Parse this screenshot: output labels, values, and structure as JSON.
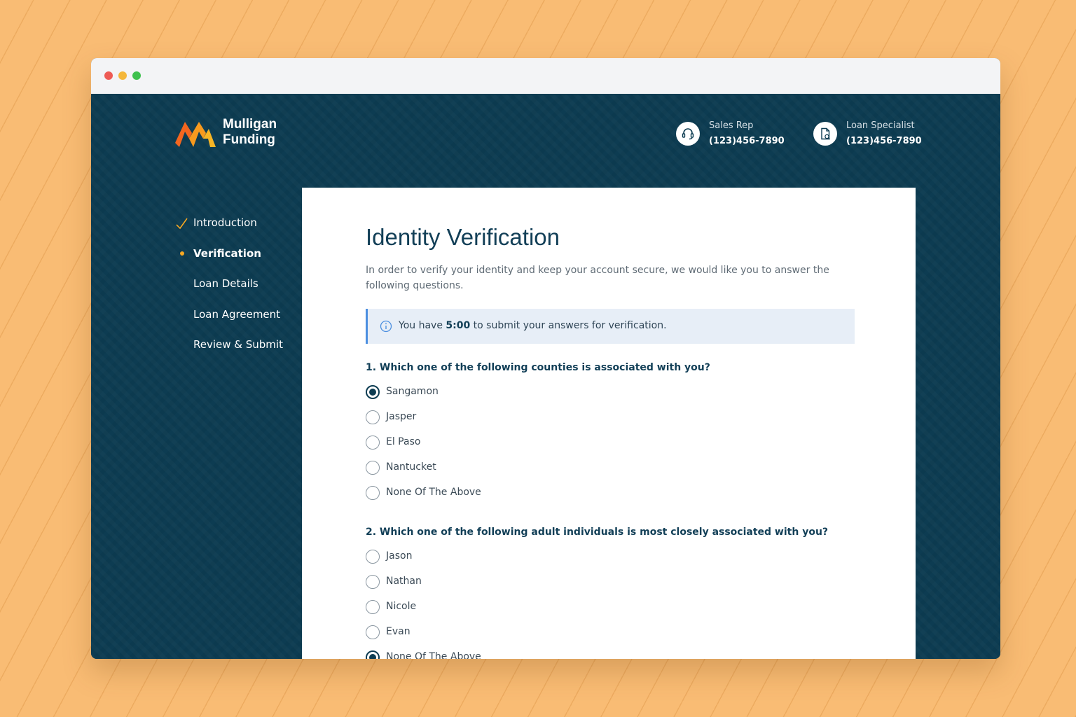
{
  "brand": {
    "line1": "Mulligan",
    "line2": "Funding"
  },
  "contacts": [
    {
      "label": "Sales Rep",
      "phone": "(123)456-7890",
      "icon": "headset-icon"
    },
    {
      "label": "Loan Specialist",
      "phone": "(123)456-7890",
      "icon": "document-search-icon"
    }
  ],
  "nav": {
    "items": [
      {
        "label": "Introduction",
        "state": "completed"
      },
      {
        "label": "Verification",
        "state": "active"
      },
      {
        "label": "Loan Details",
        "state": "upcoming"
      },
      {
        "label": "Loan Agreement",
        "state": "upcoming"
      },
      {
        "label": "Review & Submit",
        "state": "upcoming"
      }
    ]
  },
  "main": {
    "title": "Identity Verification",
    "intro": "In order to verify your identity and keep your account secure, we would like you to answer the following questions.",
    "notice": {
      "prefix": "You have ",
      "time": "5:00",
      "suffix": " to submit your answers for verification."
    },
    "questions": [
      {
        "text": "1. Which one of the following counties is associated with you?",
        "options": [
          "Sangamon",
          "Jasper",
          "El Paso",
          "Nantucket",
          "None Of The Above"
        ],
        "selected": "Sangamon"
      },
      {
        "text": "2. Which one of the following adult individuals is most closely associated with you?",
        "options": [
          "Jason",
          "Nathan",
          "Nicole",
          "Evan",
          "None Of The Above"
        ],
        "selected": "None Of The Above"
      }
    ]
  },
  "colors": {
    "navy": "#0d3c52",
    "accent": "#f7a822",
    "info": "#4c8fe0",
    "background": "#f9bc74"
  }
}
